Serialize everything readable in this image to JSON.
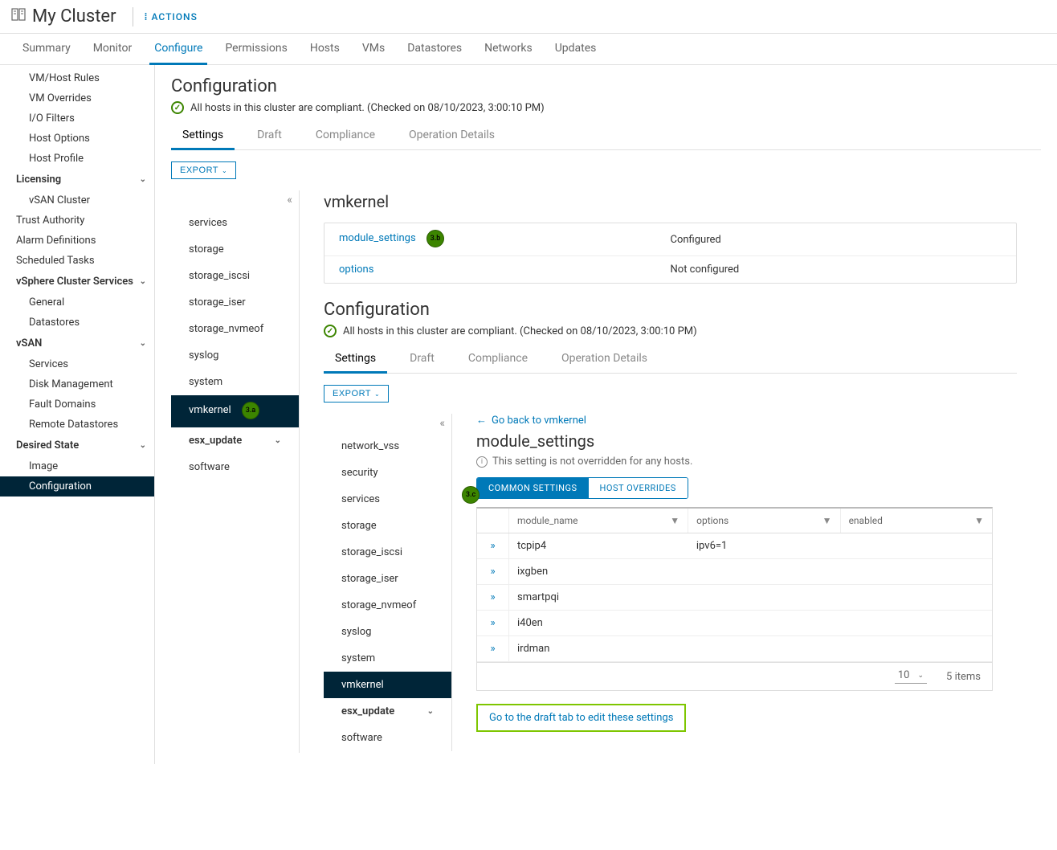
{
  "header": {
    "title": "My Cluster",
    "actions_label": "ACTIONS"
  },
  "tabs": [
    "Summary",
    "Monitor",
    "Configure",
    "Permissions",
    "Hosts",
    "VMs",
    "Datastores",
    "Networks",
    "Updates"
  ],
  "active_tab": "Configure",
  "sidebar": {
    "items_top": [
      "VM/Host Rules",
      "VM Overrides",
      "I/O Filters",
      "Host Options",
      "Host Profile"
    ],
    "licensing": {
      "label": "Licensing",
      "children": [
        "vSAN Cluster"
      ]
    },
    "items_mid": [
      "Trust Authority",
      "Alarm Definitions",
      "Scheduled Tasks"
    ],
    "vsphere_cs": {
      "label": "vSphere Cluster Services",
      "children": [
        "General",
        "Datastores"
      ]
    },
    "vsan": {
      "label": "vSAN",
      "children": [
        "Services",
        "Disk Management",
        "Fault Domains",
        "Remote Datastores"
      ]
    },
    "desired_state": {
      "label": "Desired State",
      "children": [
        "Image",
        "Configuration"
      ]
    }
  },
  "panel1": {
    "title": "Configuration",
    "compliance": "All hosts in this cluster are compliant. (Checked on 08/10/2023, 3:00:10 PM)",
    "subtabs": [
      "Settings",
      "Draft",
      "Compliance",
      "Operation Details"
    ],
    "export_label": "EXPORT",
    "nav": [
      "services",
      "storage",
      "storage_iscsi",
      "storage_iser",
      "storage_nvmeof",
      "syslog",
      "system",
      "vmkernel",
      "esx_update",
      "software"
    ],
    "main_title": "vmkernel",
    "rows": [
      {
        "key": "module_settings",
        "val": "Configured"
      },
      {
        "key": "options",
        "val": "Not configured"
      }
    ],
    "ann_a": "3.a",
    "ann_b": "3.b"
  },
  "panel2": {
    "title": "Configuration",
    "compliance": "All hosts in this cluster are compliant. (Checked on 08/10/2023, 3:00:10 PM)",
    "subtabs": [
      "Settings",
      "Draft",
      "Compliance",
      "Operation Details"
    ],
    "export_label": "EXPORT",
    "nav": [
      "network_vss",
      "security",
      "services",
      "storage",
      "storage_iscsi",
      "storage_iser",
      "storage_nvmeof",
      "syslog",
      "system",
      "vmkernel",
      "esx_update",
      "software"
    ],
    "back_link": "Go back to vmkernel",
    "main_title": "module_settings",
    "info": "This setting is not overridden for any hosts.",
    "pill_active": "COMMON SETTINGS",
    "pill_inactive": "HOST OVERRIDES",
    "ann_c": "3.c",
    "columns": [
      "module_name",
      "options",
      "enabled"
    ],
    "rows": [
      {
        "module_name": "tcpip4",
        "options": "ipv6=1",
        "enabled": ""
      },
      {
        "module_name": "ixgben",
        "options": "",
        "enabled": ""
      },
      {
        "module_name": "smartpqi",
        "options": "",
        "enabled": ""
      },
      {
        "module_name": "i40en",
        "options": "",
        "enabled": ""
      },
      {
        "module_name": "irdman",
        "options": "",
        "enabled": ""
      }
    ],
    "page_size": "10",
    "footer_items": "5 items",
    "draft_link": "Go to the draft tab to edit these settings"
  }
}
